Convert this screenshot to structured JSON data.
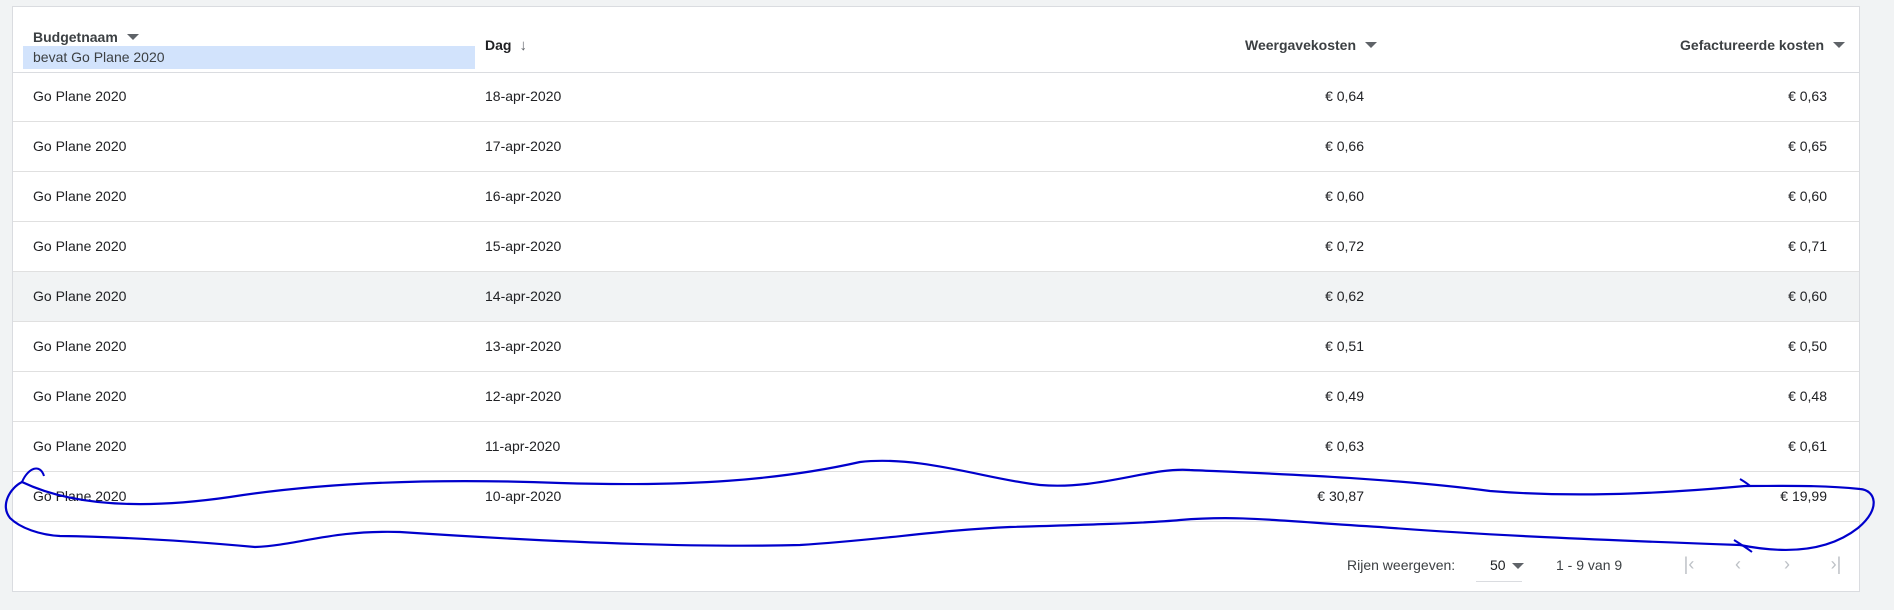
{
  "table": {
    "columns": {
      "budget": "Budgetnaam",
      "day": "Dag",
      "view_costs": "Weergavekosten",
      "billed_costs": "Gefactureerde kosten"
    },
    "filter": "bevat Go Plane 2020",
    "rows": [
      {
        "name": "Go Plane 2020",
        "day": "18-apr-2020",
        "view": "€ 0,64",
        "billed": "€ 0,63"
      },
      {
        "name": "Go Plane 2020",
        "day": "17-apr-2020",
        "view": "€ 0,66",
        "billed": "€ 0,65"
      },
      {
        "name": "Go Plane 2020",
        "day": "16-apr-2020",
        "view": "€ 0,60",
        "billed": "€ 0,60"
      },
      {
        "name": "Go Plane 2020",
        "day": "15-apr-2020",
        "view": "€ 0,72",
        "billed": "€ 0,71"
      },
      {
        "name": "Go Plane 2020",
        "day": "14-apr-2020",
        "view": "€ 0,62",
        "billed": "€ 0,60"
      },
      {
        "name": "Go Plane 2020",
        "day": "13-apr-2020",
        "view": "€ 0,51",
        "billed": "€ 0,50"
      },
      {
        "name": "Go Plane 2020",
        "day": "12-apr-2020",
        "view": "€ 0,49",
        "billed": "€ 0,48"
      },
      {
        "name": "Go Plane 2020",
        "day": "11-apr-2020",
        "view": "€ 0,63",
        "billed": "€ 0,61"
      },
      {
        "name": "Go Plane 2020",
        "day": "10-apr-2020",
        "view": "€ 30,87",
        "billed": "€ 19,99"
      }
    ]
  },
  "pagination": {
    "rows_label": "Rijen weergeven:",
    "rows_value": "50",
    "range": "1 - 9 van 9",
    "icons": [
      "first-page-icon",
      "previous-page-icon",
      "next-page-icon",
      "last-page-icon"
    ]
  },
  "colors": {
    "filter_bg": "#d2e3fc",
    "highlight_row": "#f1f3f4",
    "annotation": "#0000cc"
  }
}
